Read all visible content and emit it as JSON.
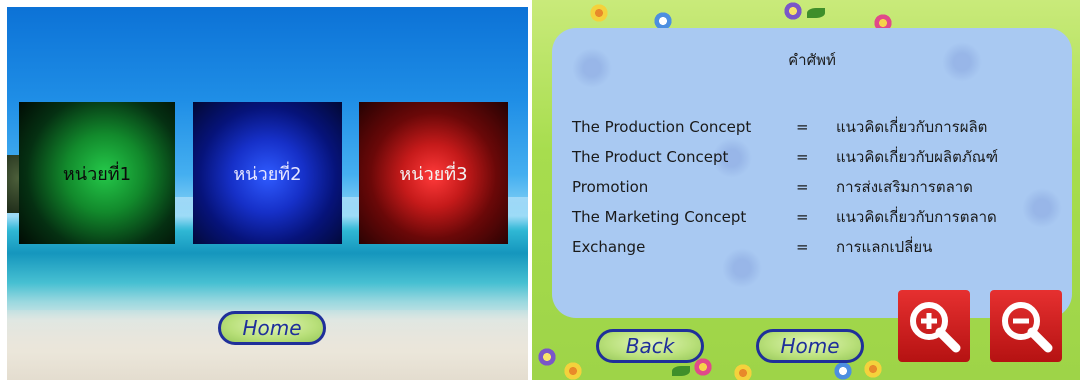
{
  "left_panel": {
    "units": [
      {
        "label": "หน่วยที่1"
      },
      {
        "label": "หน่วยที่2"
      },
      {
        "label": "หน่วยที่3"
      }
    ],
    "home_label": "Home"
  },
  "right_panel": {
    "title": "คำศัพท์",
    "equals_sign": "=",
    "terms": [
      {
        "term": "The Production Concept",
        "definition": "แนวคิดเกี่ยวกับการผลิต"
      },
      {
        "term": "The Product Concept",
        "definition": "แนวคิดเกี่ยวกับผลิตภัณฑ์"
      },
      {
        "term": "Promotion",
        "definition": "การส่งเสริมการตลาด"
      },
      {
        "term": "The Marketing Concept",
        "definition": "แนวคิดเกี่ยวกับการตลาด"
      },
      {
        "term": "Exchange",
        "definition": "การแลกเปลี่ยน"
      }
    ],
    "back_label": "Back",
    "home_label": "Home",
    "zoom_in_icon": "zoom-in-icon",
    "zoom_out_icon": "zoom-out-icon"
  },
  "colors": {
    "button_border": "#1f2f9a",
    "button_fill": "#b9e07a",
    "zoom_red": "#d42020",
    "glossary_bg": "#a9c9f2"
  }
}
